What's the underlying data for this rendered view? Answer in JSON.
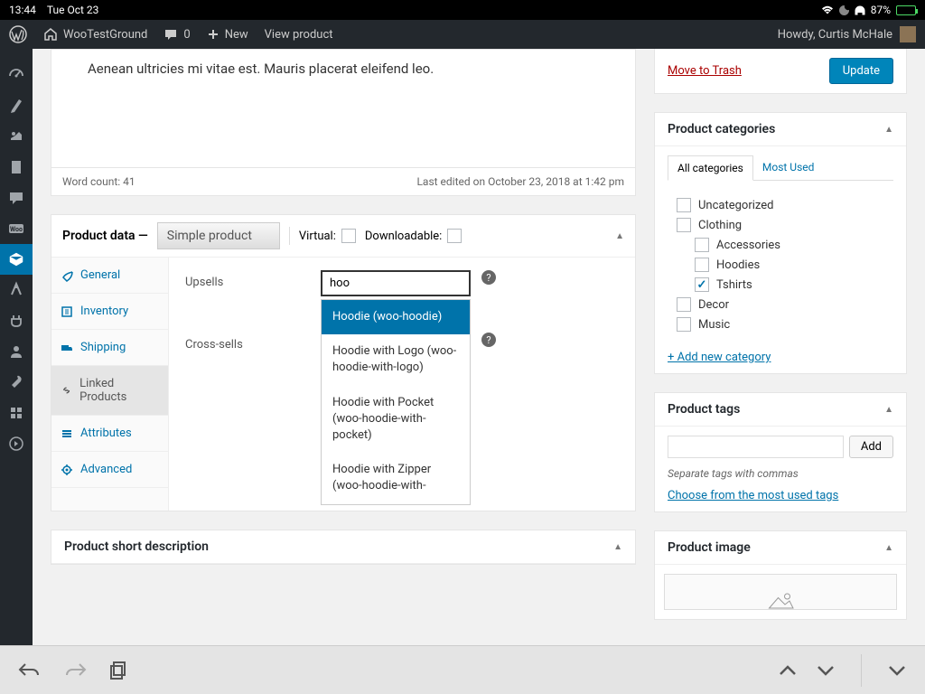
{
  "status": {
    "time": "13:44",
    "date": "Tue Oct 23",
    "battery_pct": "87%"
  },
  "toolbar": {
    "site_name": "WooTestGround",
    "comments_count": "0",
    "new_label": "New",
    "view_label": "View product",
    "howdy": "Howdy, Curtis McHale"
  },
  "editor": {
    "content": "Aenean ultricies mi vitae est. Mauris placerat eleifend leo.",
    "word_count_label": "Word count: 41",
    "last_edited": "Last edited on October 23, 2018 at 1:42 pm"
  },
  "product_data": {
    "title": "Product data —",
    "type_selected": "Simple product",
    "virtual_label": "Virtual:",
    "downloadable_label": "Downloadable:",
    "tabs": {
      "general": "General",
      "inventory": "Inventory",
      "shipping": "Shipping",
      "linked": "Linked Products",
      "attributes": "Attributes",
      "advanced": "Advanced"
    },
    "upsells_label": "Upsells",
    "crosssells_label": "Cross-sells",
    "search_value": "hoo",
    "dropdown": [
      "Hoodie (woo-hoodie)",
      "Hoodie with Logo (woo-hoodie-with-logo)",
      "Hoodie with Pocket (woo-hoodie-with-pocket)",
      "Hoodie with Zipper (woo-hoodie-with-"
    ]
  },
  "short_desc": {
    "title": "Product short description"
  },
  "publish": {
    "trash": "Move to Trash",
    "update": "Update"
  },
  "categories": {
    "title": "Product categories",
    "tab_all": "All categories",
    "tab_most": "Most Used",
    "items": {
      "uncategorized": "Uncategorized",
      "clothing": "Clothing",
      "accessories": "Accessories",
      "hoodies": "Hoodies",
      "tshirts": "Tshirts",
      "decor": "Decor",
      "music": "Music"
    },
    "add_new": "+ Add new category"
  },
  "tags": {
    "title": "Product tags",
    "add_btn": "Add",
    "help": "Separate tags with commas",
    "choose_link": "Choose from the most used tags"
  },
  "product_image": {
    "title": "Product image"
  }
}
